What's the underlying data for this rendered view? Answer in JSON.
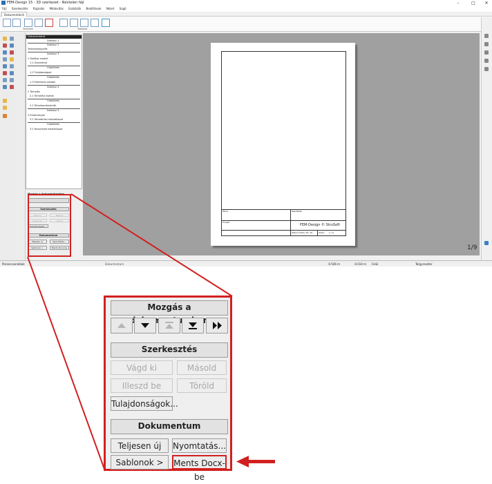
{
  "app": {
    "title": "FEM-Design 15 - 3D szerkezet - Névtelen fájl"
  },
  "menu": [
    "Fájl",
    "Szerkesztés",
    "Rajzolás",
    "Módosítás",
    "Eszközök",
    "Beállítások",
    "Nézet",
    "Súgó"
  ],
  "ribbon": {
    "active_tab": "Dokumentáció",
    "groups": [
      "Tartalom",
      "Táblázat"
    ]
  },
  "doc_panel": {
    "header": "Dokumentáció",
    "lines": [
      "Szakasz 1",
      "Szakasz 2",
      "Tartalomjegyzék",
      "Szakasz 3",
      "1 Statikai modell",
      "1.1 Geometria",
      "Oldaltörés",
      "1.2 Tulajdonságok",
      "Oldaltörés",
      "1.3 Elemtörzs adatok",
      "Szakasz 4",
      "2 Terhelés",
      "2.1 Terhelési esetek",
      "Oldaltörés",
      "2.2 Teherkombinációk",
      "Szakasz 5",
      "3 Eredmények",
      "3.1 Teherbírási határállapot",
      "Oldaltörés",
      "3.2 Használati határállapot"
    ]
  },
  "page_frame": {
    "title_label": "Téma",
    "drawn_label": "Készítette",
    "project_label": "Projekt",
    "footer": "FEM-Design © StruSoft",
    "date_label": "Dátum:",
    "date_value": "2016. 06. 30.",
    "page_label": "Oldal:",
    "page_value": "1 / 9"
  },
  "page_counter": "1/9",
  "statusbar": {
    "left": "Parancssorablak",
    "doc_tab": "Dokumentum",
    "x_coord": "-0.546 m",
    "y_coord": "-0.010 m",
    "mode": "Felül",
    "grid": "Tárgyraszter"
  },
  "zoom_panel": {
    "move_title": "Mozgás a dokumentumban",
    "edit_title": "Szerkesztés",
    "cut_label": "Vágd ki",
    "copy_label": "Másold",
    "paste_label": "Illeszd be",
    "delete_label": "Töröld",
    "properties_label": "Tulajdonságok...",
    "document_title": "Dokumentum",
    "new_label": "Teljesen új",
    "print_label": "Nyomtatás...",
    "templates_label": "Sablonok >",
    "save_docx_label": "Ments Docx-be"
  },
  "colors": {
    "highlight": "#d21f1f",
    "canvas": "#a0a0a0"
  }
}
